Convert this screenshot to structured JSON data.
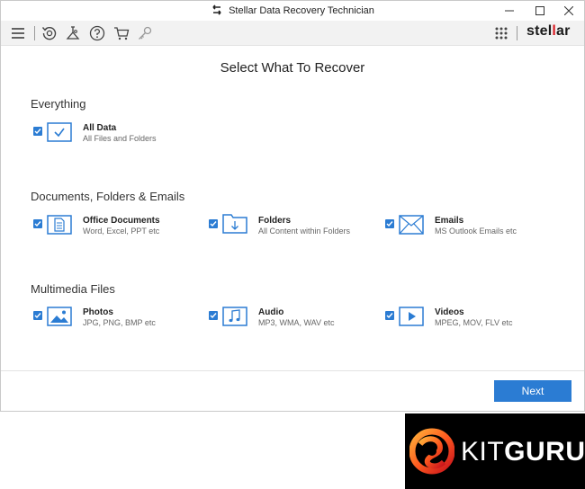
{
  "window": {
    "title": "Stellar Data Recovery Technician"
  },
  "toolbar": {
    "icons": [
      "menu-icon",
      "recovery-icon",
      "tools-icon",
      "help-icon",
      "cart-icon",
      "key-icon",
      "apps-grid-icon"
    ],
    "logo_prefix": "stel",
    "logo_mark": "l",
    "logo_suffix": "ar"
  },
  "main": {
    "heading": "Select What To Recover",
    "sections": [
      {
        "title": "Everything",
        "items": [
          {
            "label": "All Data",
            "sub": "All Files and Folders",
            "checked": true,
            "icon": "all-data-icon"
          }
        ]
      },
      {
        "title": "Documents, Folders & Emails",
        "items": [
          {
            "label": "Office Documents",
            "sub": "Word, Excel, PPT etc",
            "checked": true,
            "icon": "document-icon"
          },
          {
            "label": "Folders",
            "sub": "All Content within Folders",
            "checked": true,
            "icon": "folder-icon"
          },
          {
            "label": "Emails",
            "sub": "MS Outlook Emails etc",
            "checked": true,
            "icon": "email-icon"
          }
        ]
      },
      {
        "title": "Multimedia Files",
        "items": [
          {
            "label": "Photos",
            "sub": "JPG, PNG, BMP etc",
            "checked": true,
            "icon": "photo-icon"
          },
          {
            "label": "Audio",
            "sub": "MP3, WMA, WAV etc",
            "checked": true,
            "icon": "audio-icon"
          },
          {
            "label": "Videos",
            "sub": "MPEG, MOV, FLV etc",
            "checked": true,
            "icon": "video-icon"
          }
        ]
      }
    ],
    "next_label": "Next"
  },
  "watermark": {
    "text_light": "KIT",
    "text_bold": "GURU"
  },
  "colors": {
    "accent": "#2b7cd3",
    "logo_red": "#d71920",
    "toolbar_bg": "#f2f2f2"
  }
}
